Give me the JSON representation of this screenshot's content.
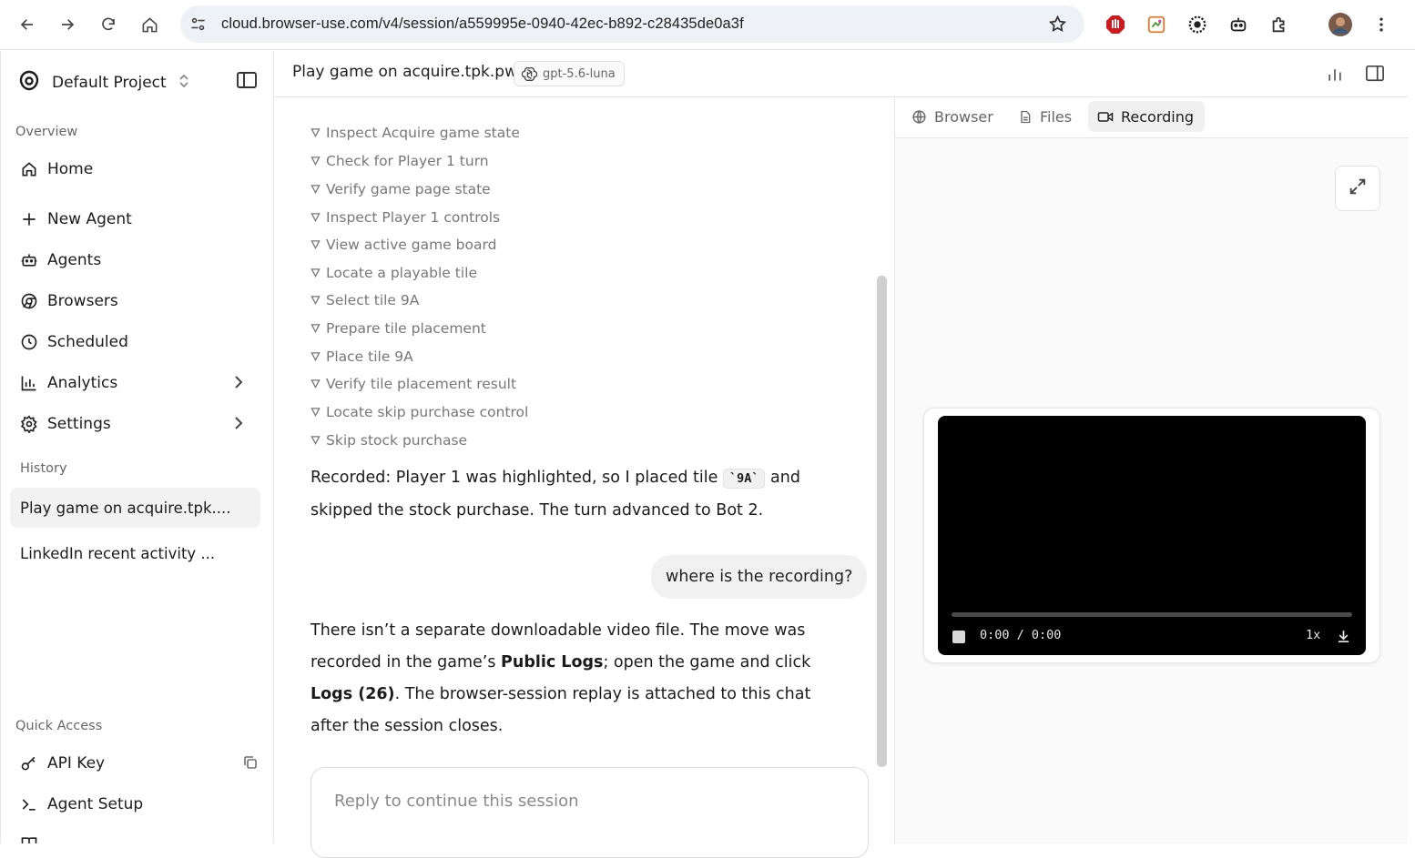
{
  "browser": {
    "url": "cloud.browser-use.com/v4/session/a559995e-0940-42ec-b892-c28435de0a3f"
  },
  "sidebar": {
    "project_name": "Default Project",
    "overview_label": "Overview",
    "nav": [
      {
        "label": "Home"
      },
      {
        "label": "New Agent"
      },
      {
        "label": "Agents"
      },
      {
        "label": "Browsers"
      },
      {
        "label": "Scheduled"
      },
      {
        "label": "Analytics"
      },
      {
        "label": "Settings"
      }
    ],
    "history_label": "History",
    "history": [
      {
        "label": "Play game on acquire.tpk...."
      },
      {
        "label": "LinkedIn recent activity ..."
      }
    ],
    "quick_access_label": "Quick Access",
    "quick": [
      {
        "label": "API Key"
      },
      {
        "label": "Agent Setup"
      }
    ]
  },
  "header": {
    "title": "Play game on acquire.tpk.pw",
    "model": "gpt-5.6-luna"
  },
  "chat": {
    "steps": [
      "Inspect Acquire game state",
      "Check for Player 1 turn",
      "Verify game page state",
      "Inspect Player 1 controls",
      "View active game board",
      "Locate a playable tile",
      "Select tile 9A",
      "Prepare tile placement",
      "Place tile 9A",
      "Verify tile placement result",
      "Locate skip purchase control",
      "Skip stock purchase"
    ],
    "msg1": {
      "pre": "Recorded: Player 1 was highlighted, so I placed tile ",
      "code": "`9A`",
      "post": " and skipped the stock purchase. The turn advanced to Bot 2."
    },
    "user_msg": "where is the recording?",
    "msg2": {
      "p1": "There isn’t a separate downloadable video file. The move was recorded in the game’s ",
      "b1": "Public Logs",
      "p2": "; open the game and click ",
      "b2": "Logs (26)",
      "p3": ". The browser-session replay is attached to this chat after the session closes."
    },
    "reply_placeholder": "Reply to continue this session"
  },
  "panel": {
    "tabs": [
      {
        "label": "Browser"
      },
      {
        "label": "Files"
      },
      {
        "label": "Recording"
      }
    ],
    "video": {
      "time": "0:00 / 0:00",
      "speed": "1x"
    }
  }
}
